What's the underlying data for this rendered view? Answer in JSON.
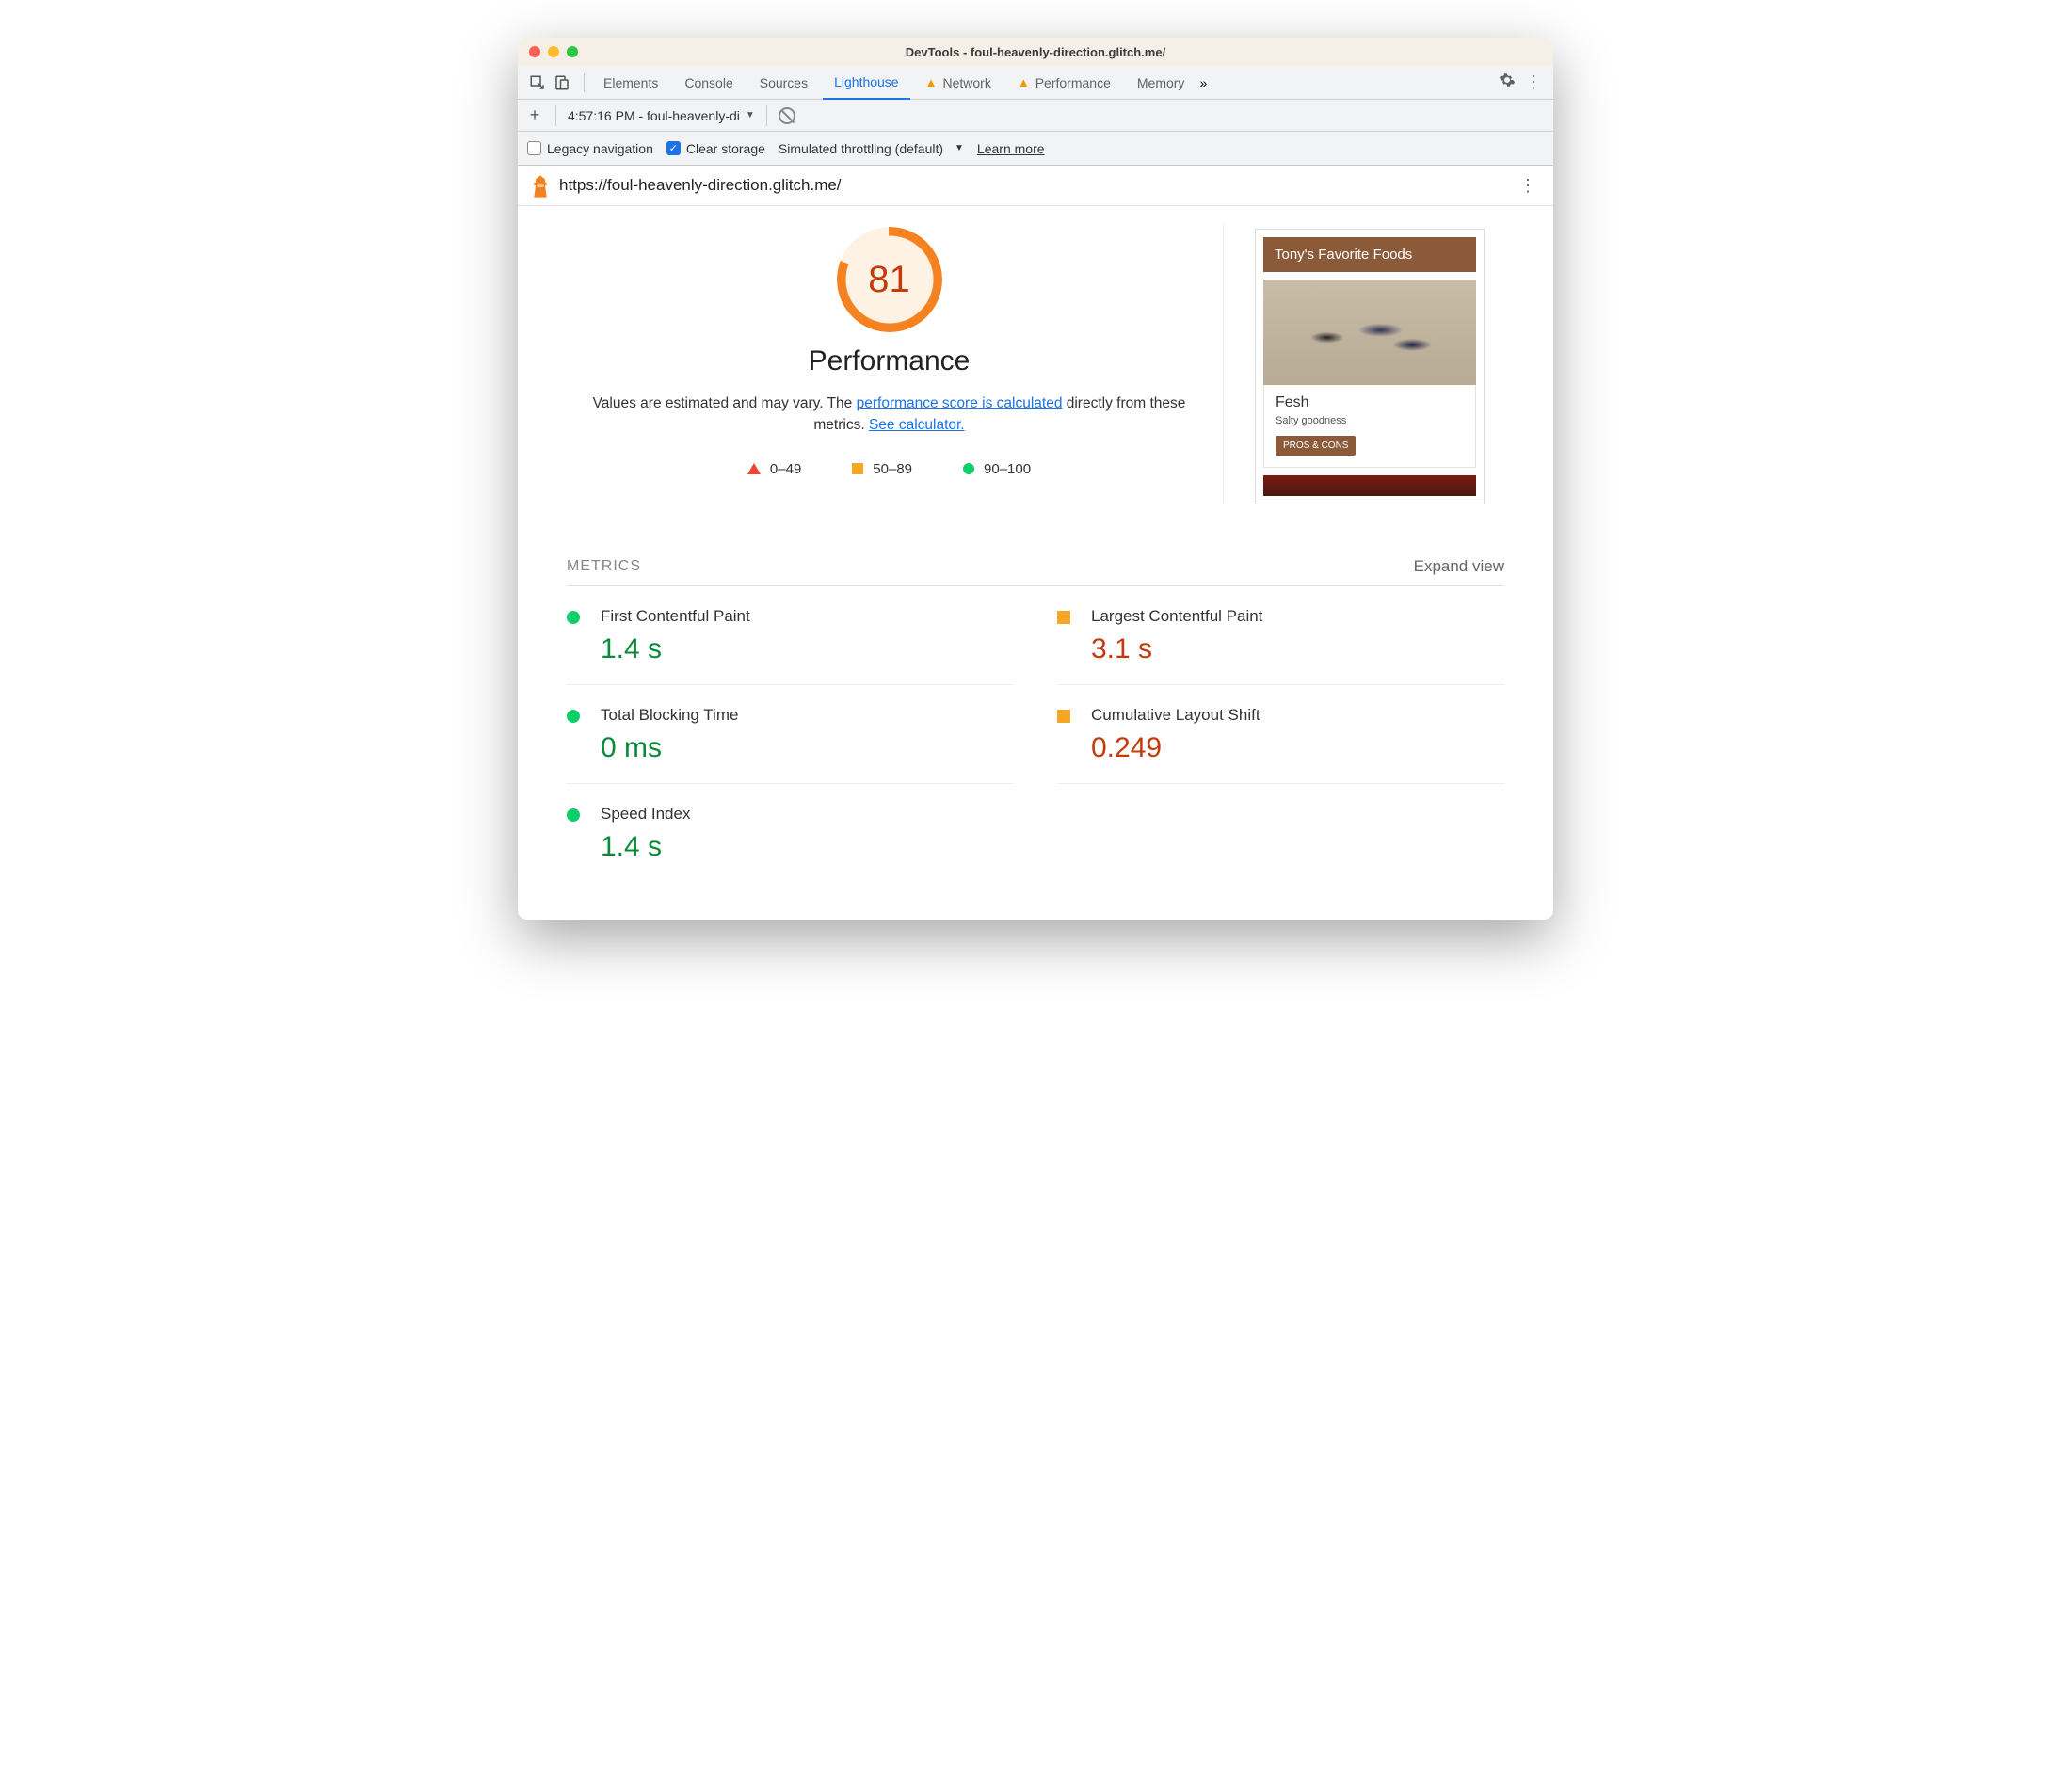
{
  "window": {
    "title": "DevTools - foul-heavenly-direction.glitch.me/"
  },
  "tabs": {
    "items": [
      "Elements",
      "Console",
      "Sources",
      "Lighthouse",
      "Network",
      "Performance",
      "Memory"
    ],
    "active": "Lighthouse",
    "warn": [
      "Network",
      "Performance"
    ]
  },
  "subbar": {
    "run_label": "4:57:16 PM - foul-heavenly-di"
  },
  "settings": {
    "legacy_label": "Legacy navigation",
    "clear_label": "Clear storage",
    "throttle_label": "Simulated throttling (default)",
    "learn_more": "Learn more"
  },
  "report": {
    "url": "https://foul-heavenly-direction.glitch.me/",
    "score": "81",
    "category": "Performance",
    "desc_prefix": "Values are estimated and may vary. The ",
    "desc_link1": "performance score is calculated",
    "desc_mid": " directly from these metrics. ",
    "desc_link2": "See calculator.",
    "legend": {
      "low": "0–49",
      "mid": "50–89",
      "high": "90–100"
    }
  },
  "thumb": {
    "header": "Tony's Favorite Foods",
    "card_title": "Fesh",
    "card_sub": "Salty goodness",
    "btn": "PROS & CONS"
  },
  "metrics": {
    "title": "METRICS",
    "expand": "Expand view",
    "items": [
      {
        "label": "First Contentful Paint",
        "value": "1.4 s",
        "status": "green"
      },
      {
        "label": "Largest Contentful Paint",
        "value": "3.1 s",
        "status": "orange"
      },
      {
        "label": "Total Blocking Time",
        "value": "0 ms",
        "status": "green"
      },
      {
        "label": "Cumulative Layout Shift",
        "value": "0.249",
        "status": "orange"
      },
      {
        "label": "Speed Index",
        "value": "1.4 s",
        "status": "green"
      }
    ]
  }
}
